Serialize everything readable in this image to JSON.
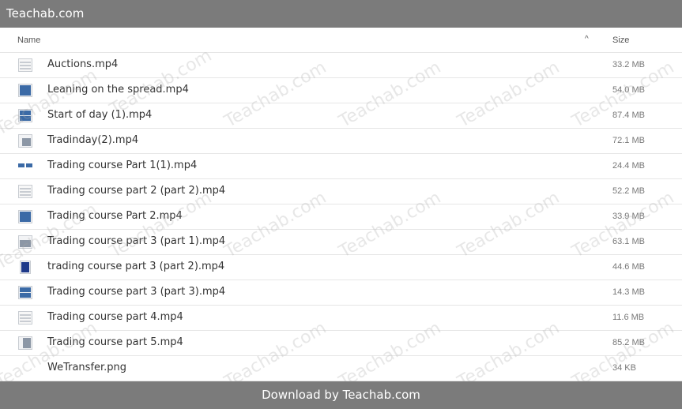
{
  "app": {
    "title": "Teachab.com"
  },
  "header": {
    "name_label": "Name",
    "size_label": "Size",
    "sort_glyph": "^"
  },
  "files": [
    {
      "name": "Auctions.mp4",
      "size": "33.2 MB",
      "icon": "document-thumbnail-icon"
    },
    {
      "name": "Leaning on the spread.mp4",
      "size": "54.0 MB",
      "icon": "video-thumbnail-icon"
    },
    {
      "name": "Start of day (1).mp4",
      "size": "87.4 MB",
      "icon": "video-thumbnail-icon"
    },
    {
      "name": "Tradinday(2).mp4",
      "size": "72.1 MB",
      "icon": "video-thumbnail-icon"
    },
    {
      "name": "Trading course Part 1(1).mp4",
      "size": "24.4 MB",
      "icon": "video-thumbnail-icon"
    },
    {
      "name": "Trading course part 2 (part 2).mp4",
      "size": "52.2 MB",
      "icon": "document-thumbnail-icon"
    },
    {
      "name": "Trading course Part 2.mp4",
      "size": "33.9 MB",
      "icon": "video-thumbnail-icon"
    },
    {
      "name": "Trading course part 3 (part 1).mp4",
      "size": "63.1 MB",
      "icon": "video-thumbnail-icon"
    },
    {
      "name": "trading course part 3 (part 2).mp4",
      "size": "44.6 MB",
      "icon": "video-thumbnail-icon"
    },
    {
      "name": "Trading course part 3 (part 3).mp4",
      "size": "14.3 MB",
      "icon": "video-thumbnail-icon"
    },
    {
      "name": "Trading course part 4.mp4",
      "size": "11.6 MB",
      "icon": "document-thumbnail-icon"
    },
    {
      "name": "Trading course part 5.mp4",
      "size": "85.2 MB",
      "icon": "video-thumbnail-icon"
    },
    {
      "name": "WeTransfer.png",
      "size": "34 KB",
      "icon": ""
    }
  ],
  "footer": {
    "label": "Download by Teachab.com"
  },
  "watermark": {
    "text": "Teachab.com"
  },
  "colors": {
    "bar": "#7b7b7b",
    "divider": "#e6e6e6",
    "thumb_blue": "#3b6aa6"
  }
}
